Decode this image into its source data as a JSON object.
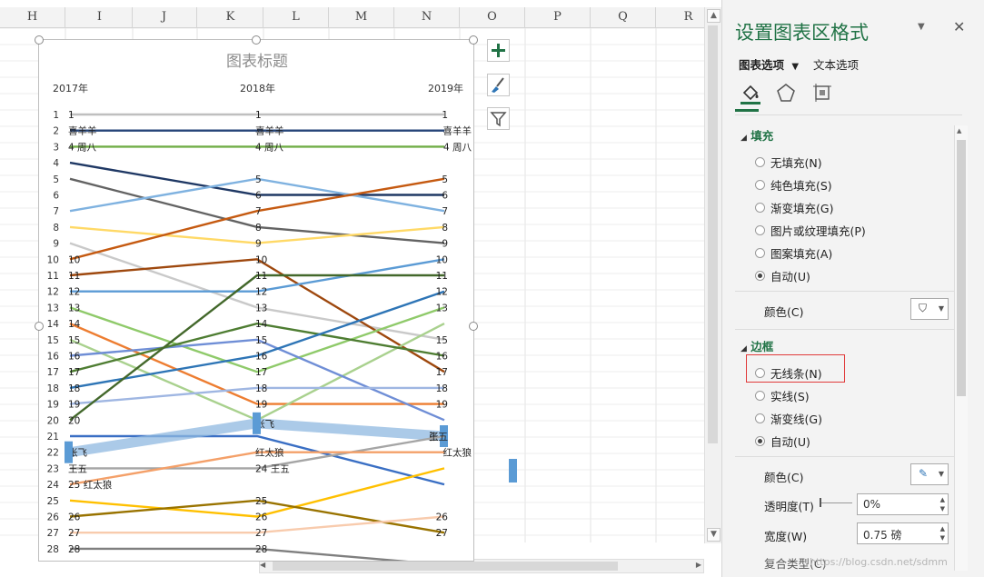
{
  "columns": [
    "H",
    "I",
    "J",
    "K",
    "L",
    "M",
    "N",
    "O",
    "P",
    "Q",
    "R"
  ],
  "chart": {
    "title": "图表标题",
    "years": [
      "2017年",
      "2018年",
      "2019年"
    ],
    "rank_axis": [
      "1",
      "2",
      "3",
      "4",
      "5",
      "6",
      "7",
      "8",
      "9",
      "10",
      "11",
      "12",
      "13",
      "14",
      "15",
      "16",
      "17",
      "18",
      "19",
      "20",
      "21",
      "22",
      "23",
      "24",
      "25",
      "26",
      "27",
      "28",
      "28"
    ],
    "colors": {
      "highlight": "#5b9bd5"
    }
  },
  "chart_data": {
    "type": "line",
    "title": "图表标题",
    "categories": [
      "2017年",
      "2018年",
      "2019年"
    ],
    "y_axis": "rank (1 at top)",
    "series": [
      {
        "values": [
          1,
          1,
          1
        ],
        "color": "#bfbfbf",
        "labels": [
          "1",
          "1",
          "1"
        ]
      },
      {
        "values": [
          2,
          2,
          2
        ],
        "color": "#264478",
        "labels": [
          "喜羊羊",
          "喜羊羊",
          "喜羊羊"
        ]
      },
      {
        "values": [
          3,
          3,
          3
        ],
        "color": "#70ad47",
        "labels": [
          "4 周八",
          "4 周八",
          "4 周八"
        ]
      },
      {
        "values": [
          4,
          6,
          6
        ],
        "color": "#1f3864",
        "labels": [
          "",
          "6",
          "6"
        ]
      },
      {
        "values": [
          5,
          8,
          9
        ],
        "color": "#636363",
        "labels": [
          "",
          "8",
          "9"
        ]
      },
      {
        "values": [
          7,
          5,
          7
        ],
        "color": "#7fb2e0",
        "labels": [
          "",
          "5",
          "7"
        ]
      },
      {
        "values": [
          8,
          9,
          8
        ],
        "color": "#ffd966",
        "labels": [
          "",
          "9",
          "8"
        ]
      },
      {
        "values": [
          9,
          13,
          15
        ],
        "color": "#c9c9c9",
        "labels": [
          "",
          "13",
          "15"
        ]
      },
      {
        "values": [
          10,
          7,
          5
        ],
        "color": "#c55a11",
        "labels": [
          "10",
          "7",
          "5"
        ]
      },
      {
        "values": [
          11,
          10,
          17
        ],
        "color": "#9e480e",
        "labels": [
          "11",
          "10",
          "17"
        ]
      },
      {
        "values": [
          12,
          12,
          10
        ],
        "color": "#5b9bd5",
        "labels": [
          "12",
          "12",
          "10"
        ]
      },
      {
        "values": [
          13,
          17,
          13
        ],
        "color": "#8fca6a",
        "labels": [
          "13",
          "17",
          "13"
        ]
      },
      {
        "values": [
          14,
          19,
          19
        ],
        "color": "#ed7d31",
        "labels": [
          "14",
          "19",
          "19"
        ]
      },
      {
        "values": [
          15,
          20,
          14
        ],
        "color": "#a9d18e",
        "labels": [
          "15",
          "",
          ""
        ]
      },
      {
        "values": [
          16,
          15,
          20
        ],
        "color": "#6f8ed6",
        "labels": [
          "16",
          "15",
          ""
        ]
      },
      {
        "values": [
          17,
          14,
          16
        ],
        "color": "#4e7d32",
        "labels": [
          "17",
          "14",
          "16"
        ]
      },
      {
        "values": [
          18,
          16,
          12
        ],
        "color": "#2e75b6",
        "labels": [
          "18",
          "16",
          "12"
        ]
      },
      {
        "values": [
          19,
          18,
          18
        ],
        "color": "#9fb6e2",
        "labels": [
          "19",
          "18",
          "18"
        ]
      },
      {
        "values": [
          20,
          11,
          11
        ],
        "color": "#43682b",
        "labels": [
          "20",
          "11",
          "11"
        ]
      },
      {
        "values": [
          21,
          21,
          24
        ],
        "color": "#3a6fc4",
        "labels": [
          "",
          "",
          ""
        ]
      },
      {
        "values": [
          22,
          20.2,
          21
        ],
        "color": "#8fb8e0",
        "labels": [
          "张飞",
          "张飞",
          "张飞"
        ]
      },
      {
        "values": [
          23,
          23,
          21
        ],
        "color": "#a5a5a5",
        "labels": [
          "王五",
          "24 王五",
          "王五"
        ]
      },
      {
        "values": [
          24,
          22,
          22
        ],
        "color": "#f4a069",
        "labels": [
          "25 红太狼",
          "红太狼",
          "红太狼"
        ]
      },
      {
        "values": [
          25,
          26,
          23
        ],
        "color": "#ffc000",
        "labels": [
          "",
          "26",
          ""
        ]
      },
      {
        "values": [
          26,
          25,
          27
        ],
        "color": "#997300",
        "labels": [
          "26",
          "25",
          "27"
        ]
      },
      {
        "values": [
          27,
          27,
          26
        ],
        "color": "#f8cbad",
        "labels": [
          "27",
          "27",
          "26"
        ]
      },
      {
        "values": [
          28,
          28,
          29
        ],
        "color": "#7f7f7f",
        "labels": [
          "28",
          "28",
          ""
        ]
      }
    ]
  },
  "chart_tools": {
    "add": "plus-icon",
    "style": "brush-icon",
    "filter": "filter-icon"
  },
  "pane": {
    "title": "设置图表区格式",
    "tabs": [
      "图表选项",
      "文本选项"
    ],
    "fill_section": "填充",
    "fill_options": [
      "无填充(N)",
      "纯色填充(S)",
      "渐变填充(G)",
      "图片或纹理填充(P)",
      "图案填充(A)",
      "自动(U)"
    ],
    "color_label": "颜色(C)",
    "border_section": "边框",
    "border_options": [
      "无线条(N)",
      "实线(S)",
      "渐变线(G)",
      "自动(U)"
    ],
    "border_color_label": "颜色(C)",
    "transparency_label": "透明度(T)",
    "transparency_value": "0%",
    "width_label": "宽度(W)",
    "width_value": "0.75 磅",
    "partial_label": "复合类型(C)",
    "watermark": "https://blog.csdn.net/sdmm"
  }
}
